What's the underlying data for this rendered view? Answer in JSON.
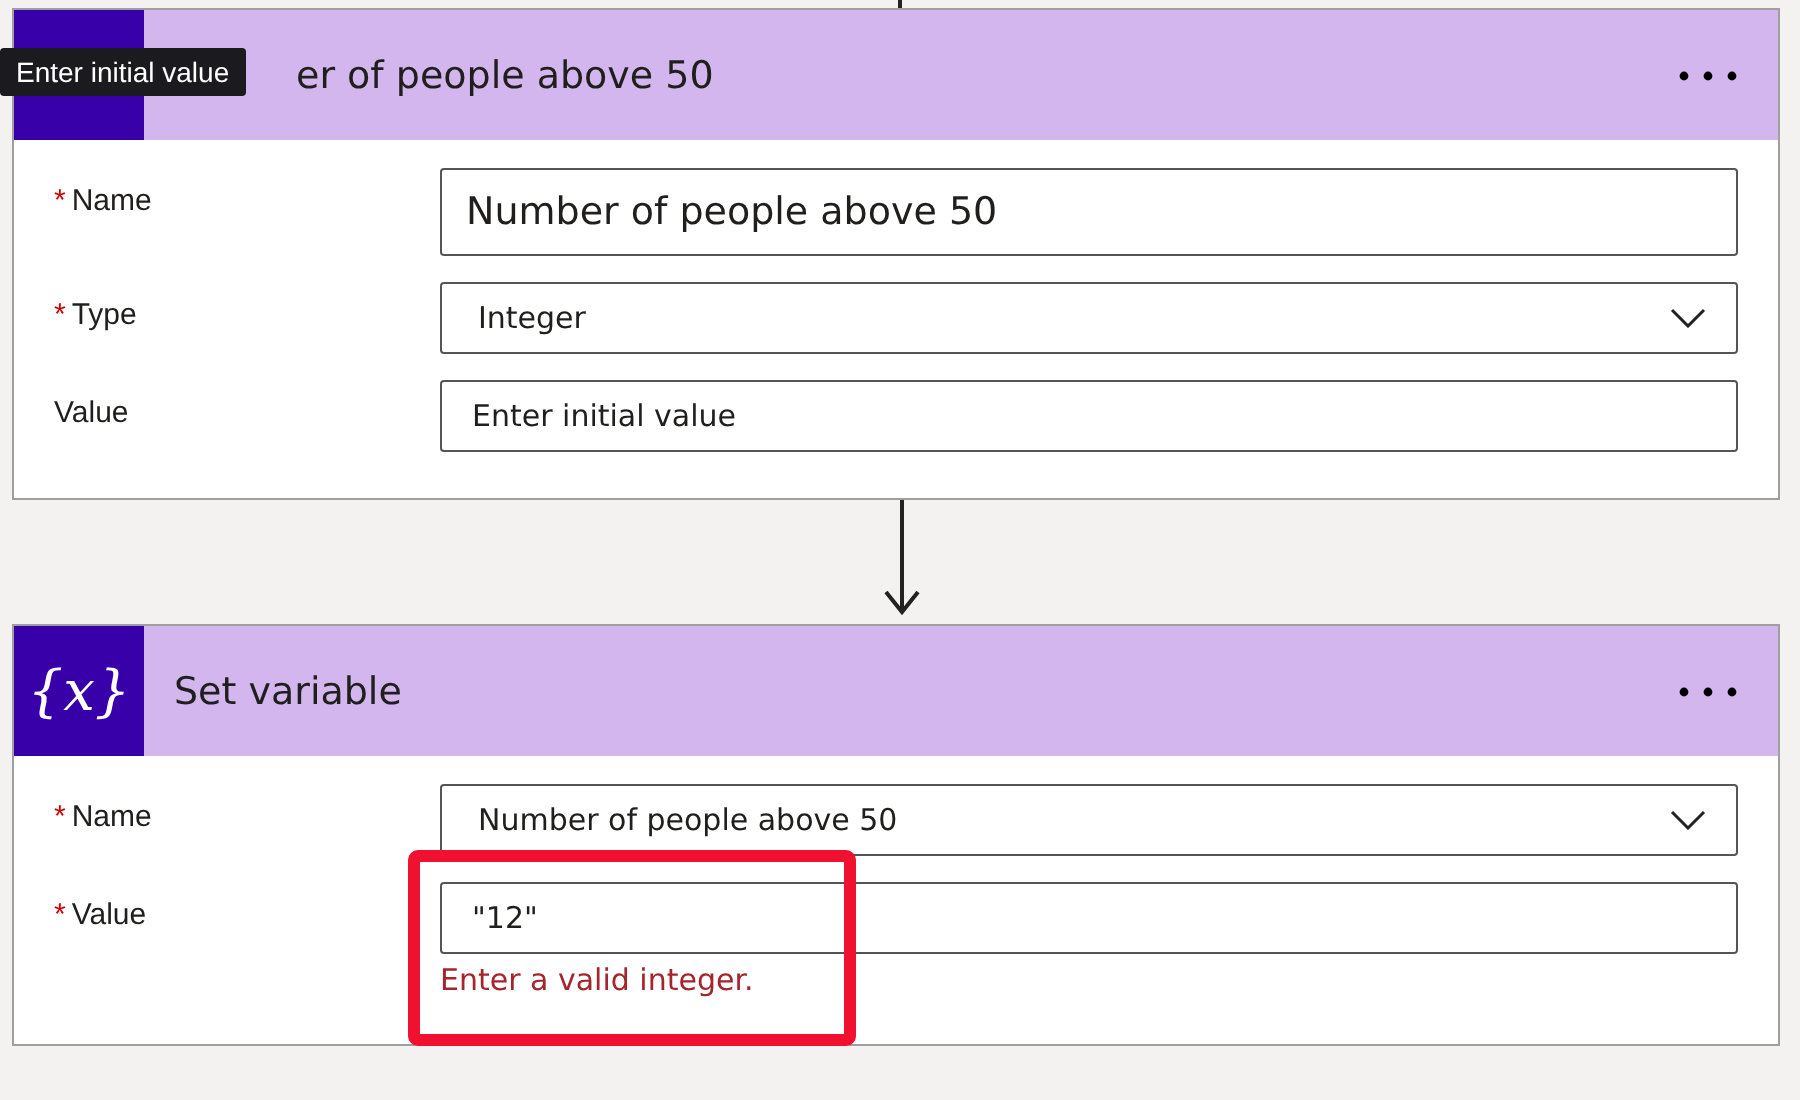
{
  "tooltip": "Enter initial value",
  "cards": [
    {
      "title": "er of people above 50",
      "fields": [
        {
          "label": "Name",
          "mark": "*",
          "kind": "text",
          "value": "Number of people above 50",
          "large": true
        },
        {
          "label": "Type",
          "mark": "*",
          "kind": "dropdown",
          "value": "Integer"
        },
        {
          "label": "Value",
          "kind": "text",
          "placeholder": "Enter initial value"
        }
      ]
    },
    {
      "title": "Set variable",
      "icon_text": "{x}",
      "fields": [
        {
          "label": "Name",
          "mark": "*",
          "kind": "dropdown",
          "value": "Number of people above 50"
        },
        {
          "label": "Value",
          "mark": "*",
          "kind": "text",
          "value": "\"12\"",
          "error": "Enter a valid integer.",
          "highlighted": true
        }
      ]
    }
  ]
}
